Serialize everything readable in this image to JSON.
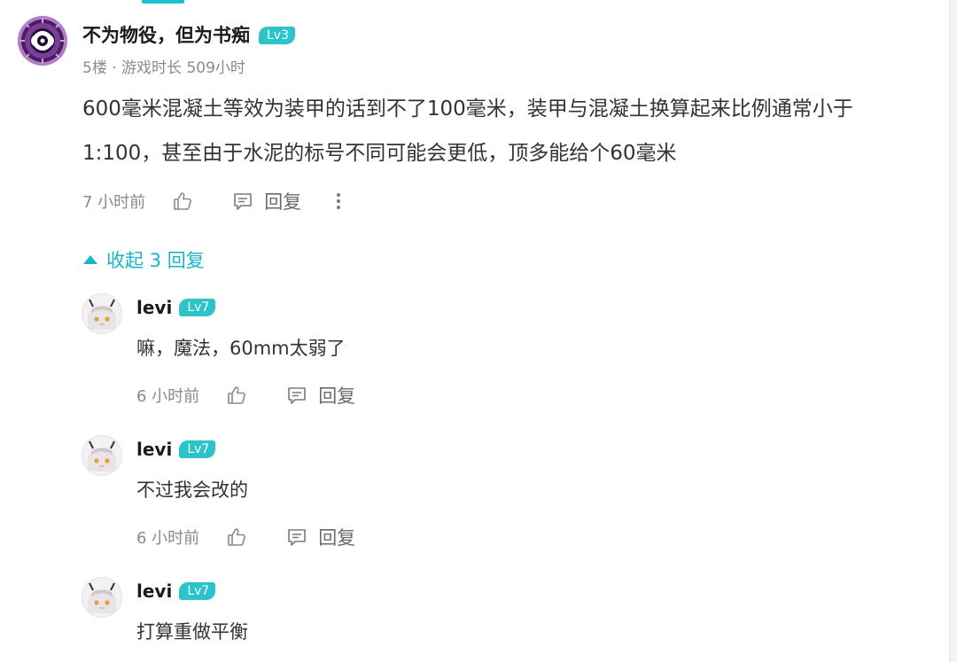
{
  "main_comment": {
    "username": "不为物役，但为书痴",
    "level": "Lv3",
    "floor": "5楼",
    "separator": "·",
    "playtime": "游戏时长 509小时",
    "text": "600毫米混凝土等效为装甲的话到不了100毫米，装甲与混凝土换算起来比例通常小于1:100，甚至由于水泥的标号不同可能会更低，顶多能给个60毫米",
    "time": "7 小时前",
    "reply_label": "回复"
  },
  "collapse_label": "收起 3 回复",
  "replies": [
    {
      "username": "levi",
      "level": "Lv7",
      "text": "嘛，魔法，60mm太弱了",
      "time": "6 小时前",
      "reply_label": "回复"
    },
    {
      "username": "levi",
      "level": "Lv7",
      "text": "不过我会改的",
      "time": "6 小时前",
      "reply_label": "回复"
    },
    {
      "username": "levi",
      "level": "Lv7",
      "text": "打算重做平衡"
    }
  ],
  "colors": {
    "accent": "#18b5c4",
    "badge": "#2cc3c9",
    "meta": "#8a8a8a"
  }
}
